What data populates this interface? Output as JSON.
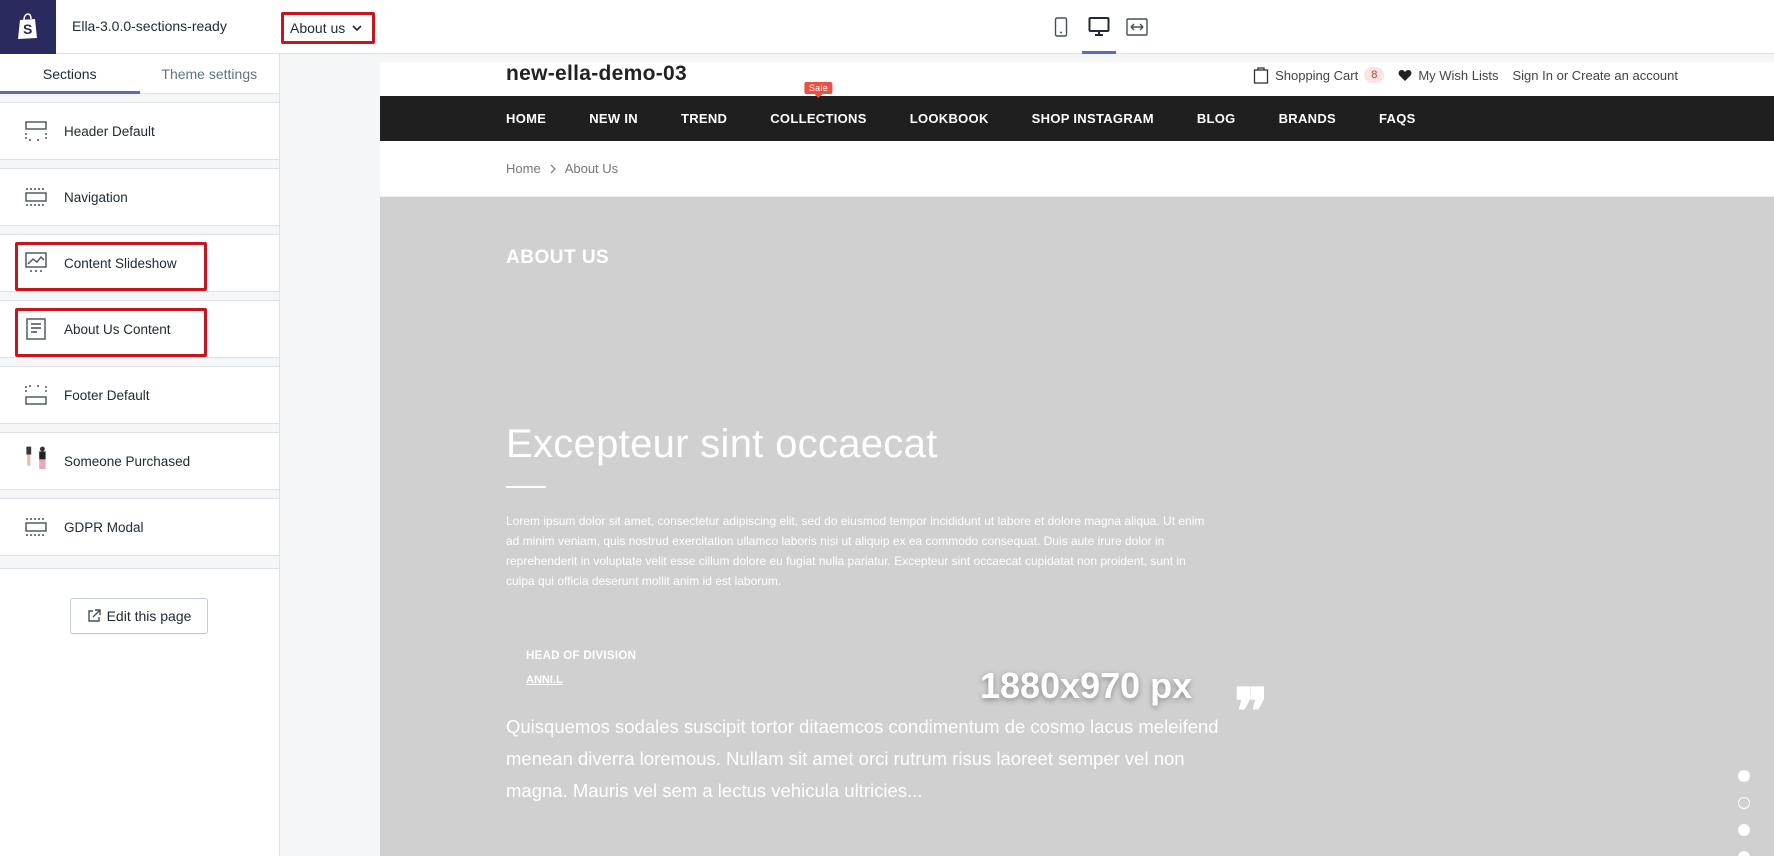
{
  "topbar": {
    "theme_name": "Ella-3.0.0-sections-ready",
    "page_selector": "About us",
    "devices": [
      "mobile",
      "desktop",
      "fullscreen"
    ],
    "active_device": "desktop"
  },
  "sidebar": {
    "tabs": [
      {
        "label": "Sections",
        "active": true
      },
      {
        "label": "Theme settings",
        "active": false
      }
    ],
    "sections": [
      {
        "label": "Header Default",
        "icon": "header-section-icon"
      },
      {
        "label": "Navigation",
        "icon": "navigation-section-icon"
      },
      {
        "label": "Content Slideshow",
        "icon": "slideshow-icon",
        "highlighted": true
      },
      {
        "label": "About Us Content",
        "icon": "text-content-icon",
        "highlighted": true
      },
      {
        "label": "Footer Default",
        "icon": "footer-section-icon"
      },
      {
        "label": "Someone Purchased",
        "icon": "product-thumbnail-icon"
      },
      {
        "label": "GDPR Modal",
        "icon": "modal-section-icon"
      }
    ],
    "edit_button": "Edit this page"
  },
  "store": {
    "name": "new-ella-demo-03",
    "cart_label": "Shopping Cart",
    "cart_count": "8",
    "wishlist_label": "My Wish Lists",
    "account_label": "Sign In or Create an account",
    "nav": [
      "HOME",
      "NEW IN",
      "TREND",
      "COLLECTIONS",
      "LOOKBOOK",
      "SHOP INSTAGRAM",
      "BLOG",
      "BRANDS",
      "FAQS"
    ],
    "sale_badge": "Sale",
    "breadcrumb": {
      "home": "Home",
      "current": "About Us"
    }
  },
  "hero": {
    "title": "ABOUT US",
    "heading": "Excepteur sint occaecat",
    "text": "Lorem ipsum dolor sit amet, consectetur adipiscing elit, sed do eiusmod tempor incididunt ut labore et dolore magna aliqua. Ut enim ad minim veniam, quis nostrud exercitation ullamco laboris nisi ut aliquip ex ea commodo consequat. Duis aute irure dolor in reprehenderit in voluptate velit esse cillum dolore eu fugiat nulla pariatur. Excepteur sint occaecat cupidatat non proident, sunt in culpa qui officia deserunt mollit anim id est laborum.",
    "role": "HEAD OF DIVISION",
    "name": "ANNI.L",
    "size_label": "1880x970 px",
    "quote_mark": "❞",
    "quote": "Quisquemos sodales suscipit tortor ditaemcos condimentum de cosmo lacus meleifend menean diverra loremous. Nullam sit amet orci rutrum risus laoreet semper vel non magna. Mauris vel sem a lectus vehicula ultricies...",
    "dots": [
      true,
      false,
      true,
      true
    ]
  },
  "colors": {
    "shopify_logo_bg": "#2a2a5e",
    "highlight_red": "#c4161c",
    "tab_accent": "#5c6ac4",
    "navbar_bg": "#1f1f1f",
    "sale_badge": "#e95144",
    "hero_bg": "#d0d0d0"
  }
}
